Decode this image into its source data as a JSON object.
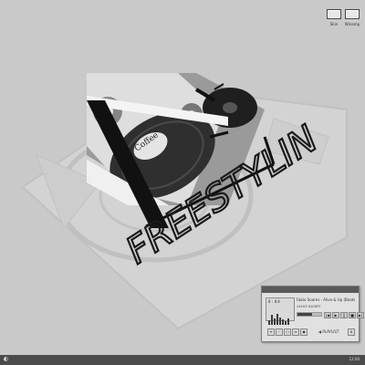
{
  "desktop": {
    "icons": [
      {
        "label": "Skin"
      },
      {
        "label": "Winamp"
      }
    ],
    "wallpaper": {
      "graffiti_text": "FREESTYLIN",
      "record_label_text": "Coffee"
    }
  },
  "player": {
    "time": "0:00",
    "track_title": "Fabio Soares - Alive & Up (Beats",
    "meta": "44KHZ  64KBPS",
    "seek_fraction": 0.6,
    "controls": [
      "|◀",
      "▶",
      "||",
      "■",
      "▶|"
    ],
    "bottom_buttons": [
      "+",
      "-",
      "○",
      "≡",
      "◆"
    ],
    "playlist_label": "◀ PLAYLIST",
    "close_glyph": "x",
    "eq_bars": [
      0.4,
      0.9,
      0.6,
      1.0,
      0.7,
      0.5,
      0.3,
      0.6
    ]
  },
  "taskbar": {
    "start_glyph": "◐",
    "clock": "12:00"
  },
  "colors": {
    "desktop_bg": "#c9c9c9",
    "taskbar_bg": "#4b4b4b",
    "player_bg": "#e1e1e1"
  }
}
